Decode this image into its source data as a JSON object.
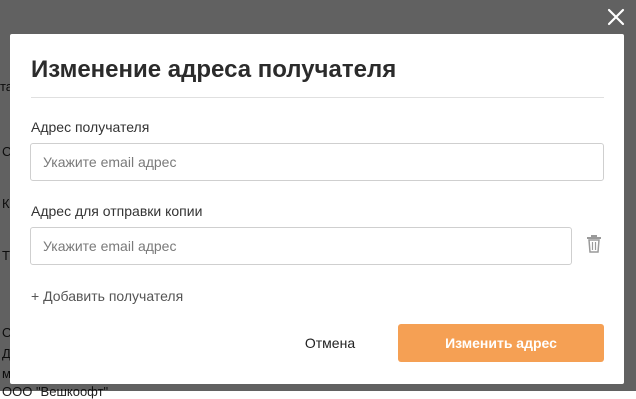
{
  "background_fragments": [
    "та",
    "С",
    "К",
    "Т",
    "О",
    "Д",
    "м",
    "ООО \"Вешкоофт\""
  ],
  "modal": {
    "title": "Изменение адреса получателя",
    "recipient_label": "Адрес получателя",
    "recipient_placeholder": "Укажите email адрес",
    "recipient_value": "",
    "copy_label": "Адрес для отправки копии",
    "copy_placeholder": "Укажите email адрес",
    "copy_value": "",
    "add_recipient_label": "+ Добавить получателя",
    "cancel_label": "Отмена",
    "submit_label": "Изменить адрес"
  },
  "icons": {
    "close": "close-icon",
    "delete": "trash-icon"
  },
  "colors": {
    "overlay": "#000000",
    "accent": "#f5a054",
    "modal_bg": "#ffffff"
  }
}
